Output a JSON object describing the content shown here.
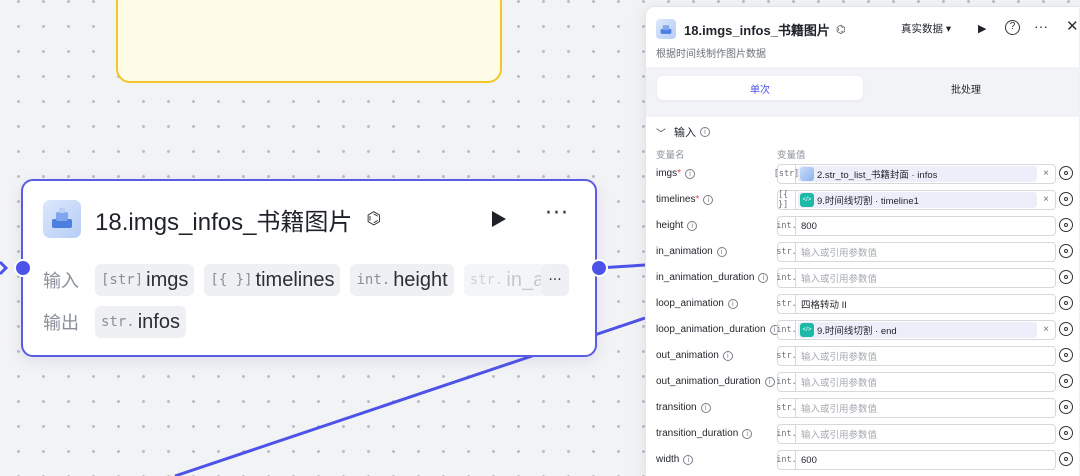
{
  "canvas": {
    "node": {
      "title": "18.imgs_infos_书籍图片",
      "input_label": "输入",
      "output_label": "输出",
      "inputs": [
        {
          "type": "[str]",
          "name": "imgs"
        },
        {
          "type": "[{ }]",
          "name": "timelines"
        },
        {
          "type": "int.",
          "name": "height"
        },
        {
          "type": "str.",
          "name": "in_an"
        }
      ],
      "more_inputs": "···",
      "outputs": [
        {
          "type": "str.",
          "name": "infos"
        }
      ]
    }
  },
  "panel": {
    "title": "18.imgs_infos_书籍图片",
    "mode": "真实数据 ▾",
    "description": "根据时间线制作图片数据",
    "tabs": [
      "单次",
      "批处理"
    ],
    "section_title": "输入",
    "col_name": "变量名",
    "col_value": "变量值",
    "params": [
      {
        "name": "imgs",
        "required": "*",
        "type": "[str]",
        "ref": "2.str_to_list_书籍封面 · infos",
        "ref_icon": "image-icon",
        "clearable": "×"
      },
      {
        "name": "timelines",
        "required": "*",
        "type": "[{ }]",
        "ref": "9.时间线切割 · timeline1",
        "ref_icon": "code-icon",
        "clearable": "×"
      },
      {
        "name": "height",
        "type": "int.",
        "value": "800"
      },
      {
        "name": "in_animation",
        "type": "str.",
        "placeholder": "输入或引用参数值"
      },
      {
        "name": "in_animation_duration",
        "type": "int.",
        "placeholder": "输入或引用参数值"
      },
      {
        "name": "loop_animation",
        "type": "str.",
        "value": "四格转动 II"
      },
      {
        "name": "loop_animation_duration",
        "type": "int.",
        "ref": "9.时间线切割 · end",
        "ref_icon": "code-icon",
        "clearable": "×"
      },
      {
        "name": "out_animation",
        "type": "str.",
        "placeholder": "输入或引用参数值"
      },
      {
        "name": "out_animation_duration",
        "type": "int.",
        "placeholder": "输入或引用参数值"
      },
      {
        "name": "transition",
        "type": "str.",
        "placeholder": "输入或引用参数值"
      },
      {
        "name": "transition_duration",
        "type": "int.",
        "placeholder": "输入或引用参数值"
      },
      {
        "name": "width",
        "type": "int.",
        "value": "600"
      }
    ]
  },
  "colors": {
    "accent": "#4d53e8",
    "node_border": "#5b5ce4",
    "warn_border": "#f3c529"
  }
}
